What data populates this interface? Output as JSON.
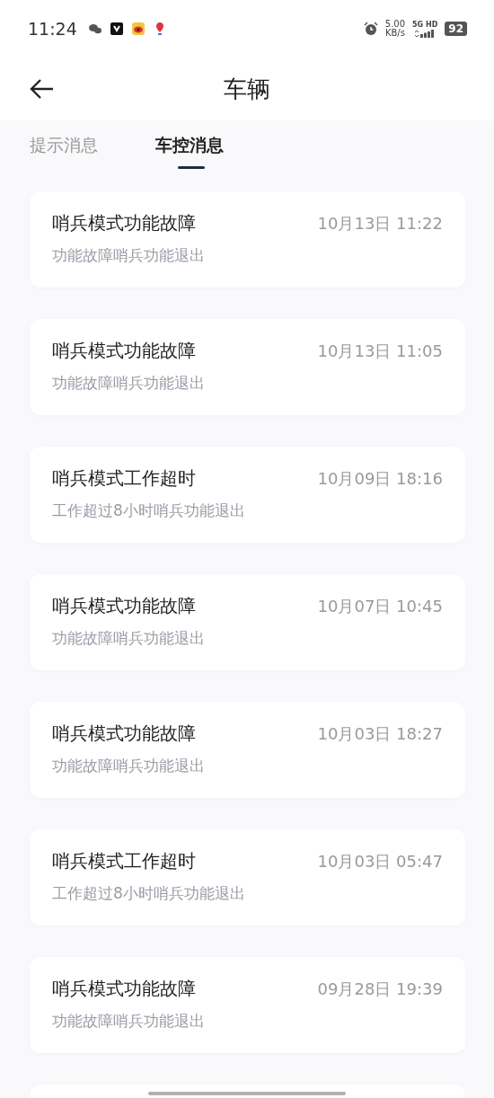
{
  "status_bar": {
    "time": "11:24",
    "net_speed": "5.00",
    "net_unit": "KB/s",
    "network": "5G HD",
    "battery": "92"
  },
  "header": {
    "title": "车辆"
  },
  "tabs": [
    {
      "label": "提示消息",
      "selected": false
    },
    {
      "label": "车控消息",
      "selected": true
    }
  ],
  "messages": [
    {
      "title": "哨兵模式功能故障",
      "time": "10月13日 11:22",
      "detail": "功能故障哨兵功能退出"
    },
    {
      "title": "哨兵模式功能故障",
      "time": "10月13日 11:05",
      "detail": "功能故障哨兵功能退出"
    },
    {
      "title": "哨兵模式工作超时",
      "time": "10月09日 18:16",
      "detail": "工作超过8小时哨兵功能退出"
    },
    {
      "title": "哨兵模式功能故障",
      "time": "10月07日 10:45",
      "detail": "功能故障哨兵功能退出"
    },
    {
      "title": "哨兵模式功能故障",
      "time": "10月03日 18:27",
      "detail": "功能故障哨兵功能退出"
    },
    {
      "title": "哨兵模式工作超时",
      "time": "10月03日 05:47",
      "detail": "工作超过8小时哨兵功能退出"
    },
    {
      "title": "哨兵模式功能故障",
      "time": "09月28日 19:39",
      "detail": "功能故障哨兵功能退出"
    }
  ]
}
